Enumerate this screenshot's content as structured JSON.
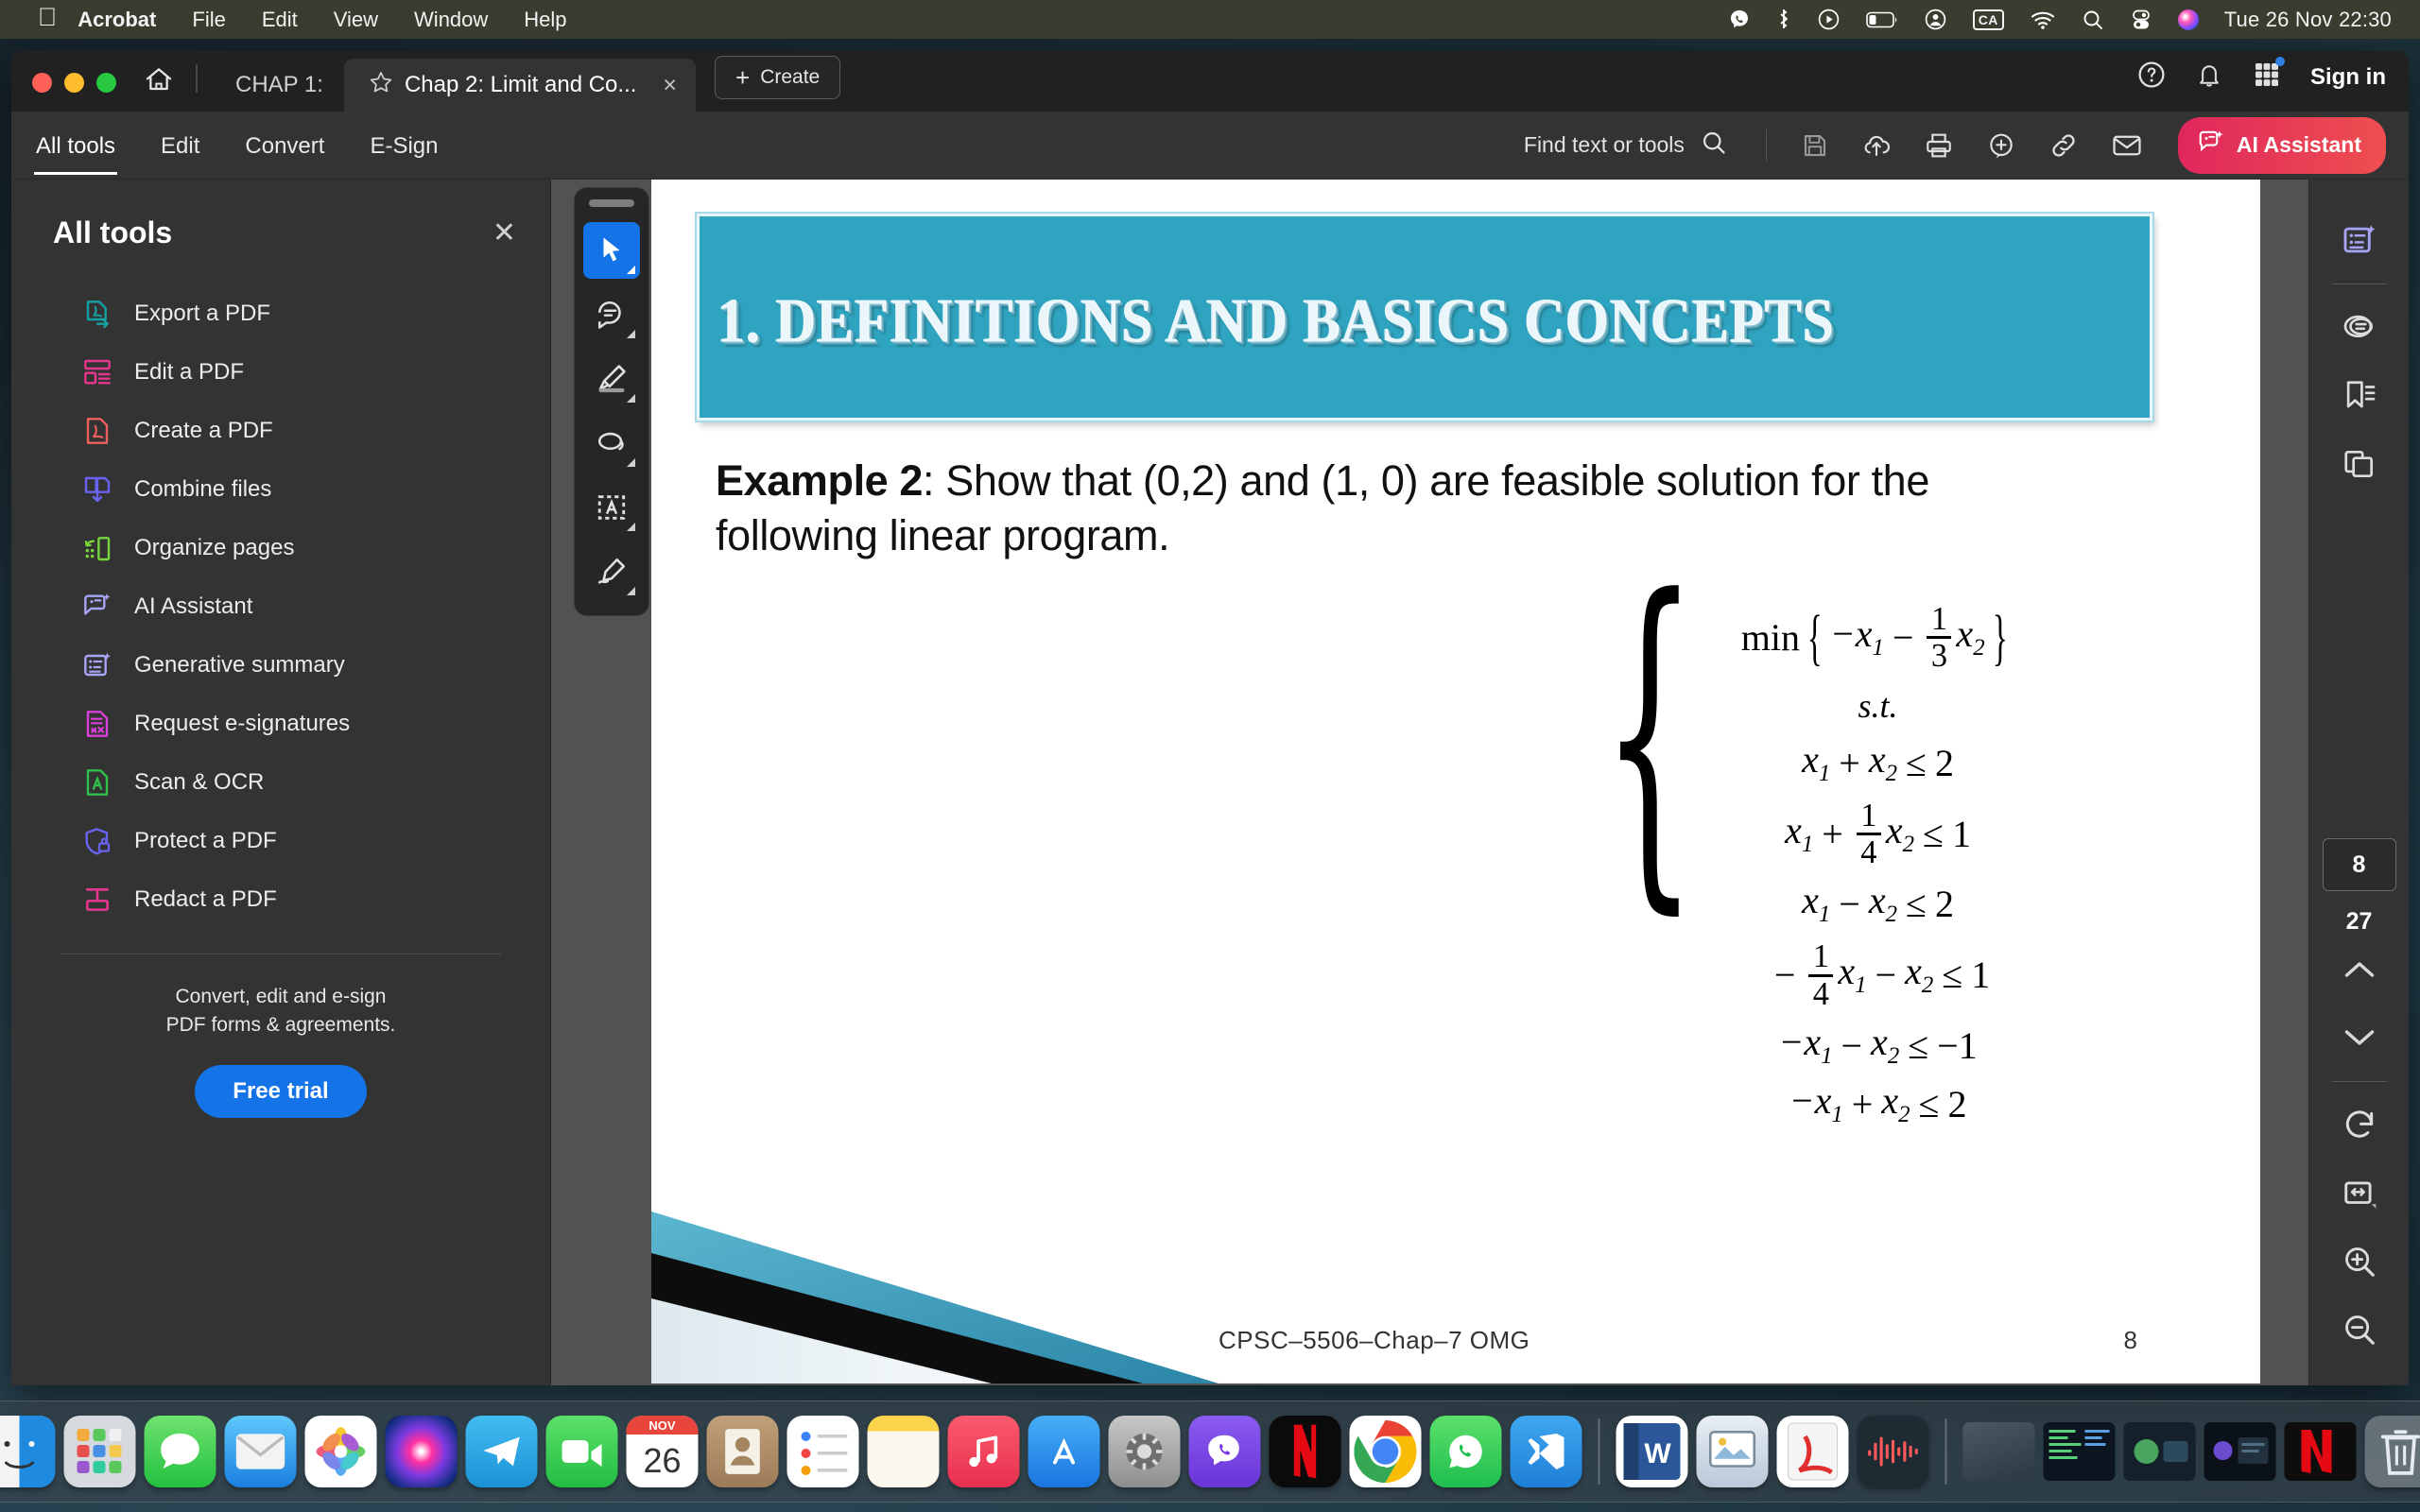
{
  "menubar": {
    "apple_icon": "apple-icon",
    "app_name": "Acrobat",
    "items": [
      "File",
      "Edit",
      "View",
      "Window",
      "Help"
    ],
    "status_icons": [
      "viber-icon",
      "bluetooth-icon",
      "playback-icon",
      "battery-icon",
      "user-icon",
      "ca-input-icon",
      "wifi-icon",
      "spotlight-search-icon",
      "control-center-icon",
      "siri-icon"
    ],
    "ca_badge": "CA",
    "clock": "Tue 26 Nov  22:30"
  },
  "window": {
    "home_icon": "home-icon",
    "tabs": [
      {
        "title": "CHAP 1:",
        "active": false,
        "star": false
      },
      {
        "title": "Chap 2:  Limit and Co...",
        "active": true,
        "star": true,
        "close": "×"
      }
    ],
    "create_label": "Create",
    "create_plus": "+",
    "help_icon": "help-circle-icon",
    "bell_icon": "notification-bell-icon",
    "apps_icon": "apps-grid-icon",
    "sign_in": "Sign in"
  },
  "toolsbar": {
    "tabs": [
      "All tools",
      "Edit",
      "Convert",
      "E-Sign"
    ],
    "selected_tab": "All tools",
    "find_label": "Find text or tools",
    "find_icon": "search-icon",
    "icons": [
      "save-icon",
      "cloud-upload-icon",
      "print-icon",
      "add-comment-icon",
      "share-link-icon",
      "email-icon"
    ],
    "ai_assistant_label": "AI Assistant",
    "ai_assistant_icon": "ai-sparkle-icon",
    "ai_accent_color": "#e0275c"
  },
  "sidebar": {
    "title": "All tools",
    "close_icon": "close-icon",
    "items": [
      {
        "label": "Export a PDF",
        "icon": "export-pdf-icon",
        "color": "#15a0a3"
      },
      {
        "label": "Edit a PDF",
        "icon": "edit-pdf-icon",
        "color": "#e8368f"
      },
      {
        "label": "Create a PDF",
        "icon": "create-pdf-icon",
        "color": "#ec5f5f"
      },
      {
        "label": "Combine files",
        "icon": "combine-files-icon",
        "color": "#6a63f0"
      },
      {
        "label": "Organize pages",
        "icon": "organize-pages-icon",
        "color": "#76d63c"
      },
      {
        "label": "AI Assistant",
        "icon": "ai-assistant-icon",
        "color": "#a7a4f5"
      },
      {
        "label": "Generative summary",
        "icon": "generative-summary-icon",
        "color": "#a7a4f5"
      },
      {
        "label": "Request e-signatures",
        "icon": "request-esignatures-icon",
        "color": "#d93fd9"
      },
      {
        "label": "Scan & OCR",
        "icon": "scan-ocr-icon",
        "color": "#2fc14a"
      },
      {
        "label": "Protect a PDF",
        "icon": "protect-pdf-icon",
        "color": "#6a63f0"
      },
      {
        "label": "Redact a PDF",
        "icon": "redact-pdf-icon",
        "color": "#e8368f"
      }
    ],
    "promo_line1": "Convert, edit and e-sign",
    "promo_line2": "PDF forms & agreements.",
    "free_trial_label": "Free trial",
    "free_trial_color": "#1473e6"
  },
  "vertical_toolbar": {
    "buttons": [
      {
        "icon": "select-cursor-icon",
        "active": true
      },
      {
        "icon": "add-comment-bubble-icon",
        "active": false
      },
      {
        "icon": "highlight-pen-icon",
        "active": false
      },
      {
        "icon": "draw-lasso-icon",
        "active": false
      },
      {
        "icon": "select-text-box-icon",
        "active": false
      },
      {
        "icon": "signature-pen-icon",
        "active": false
      }
    ]
  },
  "document": {
    "banner_title": "1. DEFINITIONS AND BASICS CONCEPTS",
    "banner_color": "#2fa4c0",
    "example_prefix": "Example 2",
    "example_text": ": Show that (0,2) and (1, 0) are feasible solution for the following linear program.",
    "math": {
      "objective_prefix": "min",
      "objective": "−x₁ − (1/3)x₂",
      "objective_frac_num": "1",
      "objective_frac_den": "3",
      "st_label": "s.t.",
      "constraints": [
        "x₁ + x₂ ≤ 2",
        "x₁ + (1/4)x₂ ≤ 1",
        "x₁ − x₂ ≤ 2",
        "−(1/4)x₁ − x₂ ≤ 1",
        "−x₁ − x₂ ≤ −1",
        "−x₁ + x₂ ≤ 2"
      ]
    },
    "footer_text": "CPSC–5506–Chap–7  OMG",
    "footer_page": "8"
  },
  "rail": {
    "top_icons": [
      "generative-summary-icon",
      "comment-icon",
      "bookmark-list-icon",
      "page-thumbnails-icon"
    ],
    "current_page": "8",
    "total_pages": "27",
    "prev_icon": "chevron-up-icon",
    "next_icon": "chevron-down-icon",
    "bottom_icons": [
      "rotate-icon",
      "fit-page-icon",
      "zoom-in-icon",
      "zoom-out-icon"
    ]
  },
  "dock": {
    "apps": [
      {
        "name": "finder-icon",
        "running": true
      },
      {
        "name": "launchpad-icon",
        "running": true
      },
      {
        "name": "messages-icon",
        "running": false
      },
      {
        "name": "mail-icon",
        "running": false
      },
      {
        "name": "photos-icon",
        "running": false
      },
      {
        "name": "siri-icon",
        "running": false
      },
      {
        "name": "telegram-icon",
        "running": false
      },
      {
        "name": "facetime-icon",
        "running": false
      },
      {
        "name": "calendar-icon",
        "running": false,
        "month": "NOV",
        "day": "26"
      },
      {
        "name": "contacts-icon",
        "running": false
      },
      {
        "name": "reminders-icon",
        "running": false
      },
      {
        "name": "notes-icon",
        "running": false
      },
      {
        "name": "music-icon",
        "running": false
      },
      {
        "name": "app-store-icon",
        "running": false
      },
      {
        "name": "settings-icon",
        "running": false
      },
      {
        "name": "viber-icon",
        "running": true
      },
      {
        "name": "netflix-icon",
        "running": false
      },
      {
        "name": "chrome-icon",
        "running": true
      },
      {
        "name": "whatsapp-icon",
        "running": false
      },
      {
        "name": "vscode-icon",
        "running": false
      },
      {
        "name": "word-icon",
        "running": true
      },
      {
        "name": "preview-icon",
        "running": true
      },
      {
        "name": "acrobat-icon",
        "running": true
      },
      {
        "name": "audacity-icon",
        "running": false
      },
      {
        "name": "trash-icon",
        "running": false
      }
    ]
  }
}
